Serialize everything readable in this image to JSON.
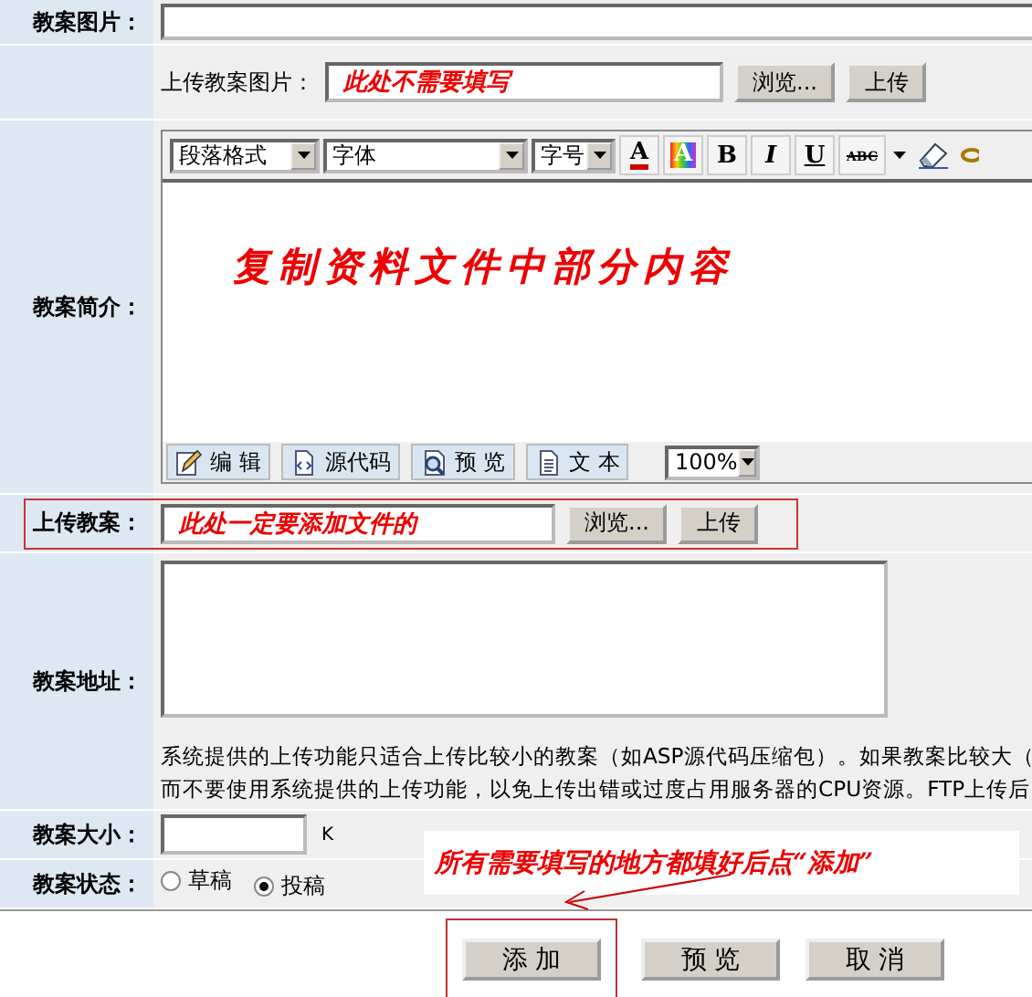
{
  "cover_image": {
    "label": "教案图片："
  },
  "cover_upload": {
    "label": "上传教案图片：",
    "note": "此处不需要填写",
    "browse": "浏览...",
    "upload": "上传"
  },
  "intro": {
    "label": "教案简介：",
    "paragraph": "段落格式",
    "font": "字体",
    "size": "字号",
    "toolbar": [
      {
        "kind": "font-color",
        "label": "A"
      },
      {
        "kind": "back-color",
        "label": "A"
      },
      {
        "kind": "text",
        "label": "B"
      },
      {
        "kind": "italic",
        "label": "I"
      },
      {
        "kind": "underline",
        "label": "U"
      },
      {
        "kind": "spell",
        "label": "ABC"
      },
      {
        "kind": "caret"
      },
      {
        "kind": "eraser"
      },
      {
        "kind": "link"
      }
    ],
    "content": "复制资料文件中部分内容",
    "modes": [
      {
        "kind": "edit",
        "label": "编 辑"
      },
      {
        "kind": "source",
        "label": "源代码"
      },
      {
        "kind": "preview",
        "label": "预 览"
      },
      {
        "kind": "text",
        "label": "文 本"
      }
    ],
    "zoom": "100%"
  },
  "lesson_upload": {
    "label": "上传教案：",
    "note": "此处一定要添加文件的",
    "browse": "浏览...",
    "upload": "上传",
    "highlighted": true
  },
  "address": {
    "label": "教案地址：",
    "help": [
      "系统提供的上传功能只适合上传比较小的教案（如ASP源代码压缩包）。如果教案比较大（",
      "而不要使用系统提供的上传功能，以免上传出错或过度占用服务器的CPU资源。FTP上传后"
    ]
  },
  "size": {
    "label": "教案大小：",
    "unit": "K"
  },
  "status": {
    "label": "教案状态：",
    "options": [
      {
        "label": "草稿",
        "selected": false
      },
      {
        "label": "投稿",
        "selected": true
      }
    ]
  },
  "annotation": {
    "text": "所有需要填写的地方都填好后点“添加”"
  },
  "actions": [
    {
      "label": "添 加",
      "highlighted": true
    },
    {
      "label": "预 览",
      "highlighted": false
    },
    {
      "label": "取 消",
      "highlighted": false
    }
  ]
}
